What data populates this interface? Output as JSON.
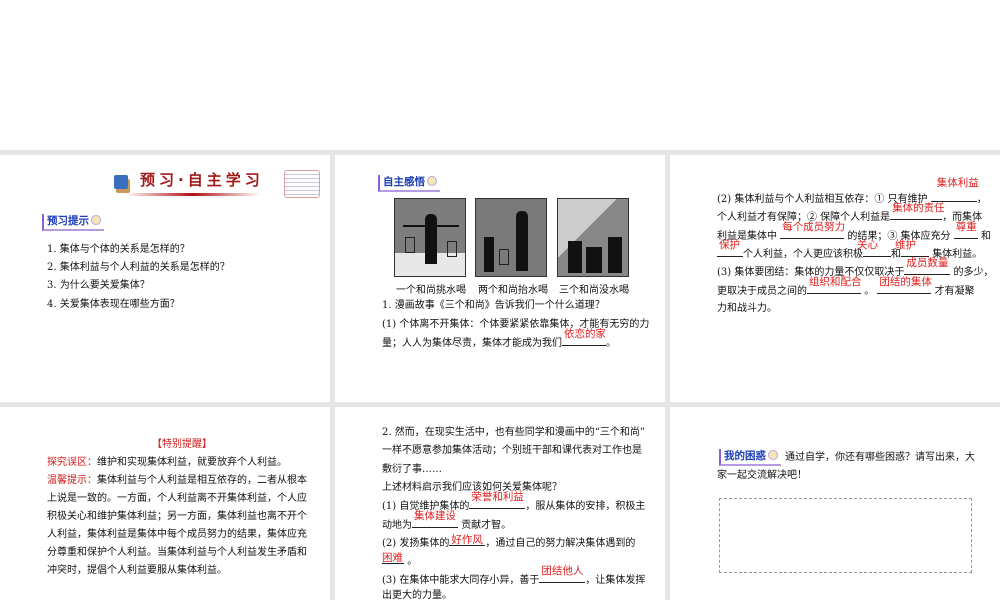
{
  "slide1": {
    "banner_title": "预习·自主学习",
    "tag": "预习提示",
    "items": [
      "1. 集体与个体的关系是怎样的？",
      "2. 集体利益与个人利益的关系是怎样的？",
      "3. 为什么要关爱集体？",
      "4. 关爱集体表现在哪些方面？"
    ]
  },
  "slide2": {
    "tag": "自主感悟",
    "captions": [
      "一个和尚挑水喝",
      "两个和尚抬水喝",
      "三个和尚没水喝"
    ],
    "q1": "1. 漫画故事《三个和尚》告诉我们一个什么道理？",
    "p1a": "(1) 个体离不开集体：个体要紧紧依靠集体，才能有无穷的力",
    "p1b": "量；人人为集体尽责，集体才能成为我们",
    "a1": "依恋的家",
    "end": "。"
  },
  "slide3": {
    "l1": "(2) 集体利益与个人利益相互依存：① 只有维护",
    "a1": "集体利益",
    "l2": "个人利益才有保障；② 保障个人利益是",
    "a2": "集体的责任",
    "l2b": "，而集体",
    "l3": "利益是集体中",
    "a3": "每个成员努力",
    "l3b": "的结果；③ 集体应充分",
    "a4": "尊重",
    "l3c": "和",
    "a5": "保护",
    "l4": "个人利益，个人更应该积极",
    "a6": "关心",
    "l4b": "和",
    "a7": "维护",
    "l4c": "集体利益。",
    "l5": "(3) 集体要团结：集体的力量不仅仅取决于",
    "a8": "成员数量",
    "l5b": "的多少，",
    "l6": "更取决于成员之间的",
    "a9": "组织和配合",
    "l6b": "。",
    "a10": "团结的集体",
    "l6c": "才有凝聚",
    "l7": "力和战斗力。",
    "comma": "，"
  },
  "slide4": {
    "heading": "【特别提醒】",
    "label1": "探究误区：",
    "text1": "维护和实现集体利益，就要放弃个人利益。",
    "label2": "温馨提示：",
    "lines": [
      "集体利益与个人利益是相互依存的，二者从根本",
      "上说是一致的。一方面，个人利益离不开集体利益，个人应",
      "积极关心和维护集体利益；另一方面，集体利益也离不开个",
      "人利益，集体利益是集体中每个成员努力的结果，集体应充",
      "分尊重和保护个人利益。当集体利益与个人利益发生矛盾和",
      "冲突时，提倡个人利益要服从集体利益。"
    ]
  },
  "slide5": {
    "l1": "2. 然而，在现实生活中，也有些同学和漫画中的“三个和尚”",
    "l2": "一样不愿意参加集体活动；个别班干部和课代表对工作也是",
    "l3": "敷衍了事……",
    "l4": "上述材料启示我们应该如何关爱集体呢？",
    "l5": "(1) 自觉维护集体的",
    "a1": "荣誉和利益",
    "l5b": "，服从集体的安排，积极主",
    "l6": "动地为",
    "a2": "集体建设",
    "l6b": "贡献才智。",
    "l7": "(2) 发扬集体的",
    "a3": "好作风",
    "l7b": "，通过自己的努力解决集体遇到的",
    "a4": "困难",
    "l8b": "。",
    "l9": "(3) 在集体中能求大同存小异，善于",
    "a5": "团结他人",
    "l9b": "，让集体发挥",
    "l10": "出更大的力量。"
  },
  "slide6": {
    "tag": "我的困惑",
    "l1": "通过自学，你还有哪些困惑？请写出来，大",
    "l2": "家一起交流解决吧！"
  }
}
